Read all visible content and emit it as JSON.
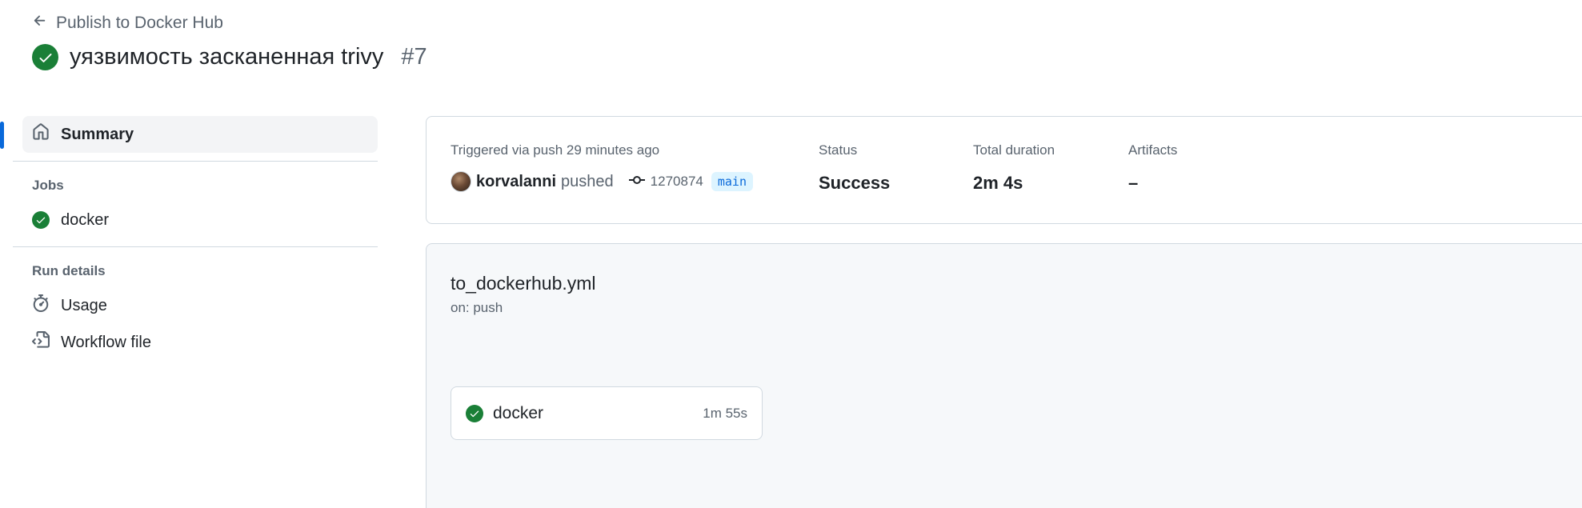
{
  "header": {
    "back_label": "Publish to Docker Hub",
    "title": "уязвимость засканенная trivy",
    "run_number": "#7"
  },
  "sidebar": {
    "summary_label": "Summary",
    "jobs_heading": "Jobs",
    "jobs": [
      {
        "label": "docker"
      }
    ],
    "run_details_heading": "Run details",
    "usage_label": "Usage",
    "workflow_file_label": "Workflow file"
  },
  "summary": {
    "triggered_label": "Triggered via push 29 minutes ago",
    "actor": "korvalanni",
    "action": "pushed",
    "commit_sha": "1270874",
    "branch": "main",
    "status_label": "Status",
    "status_value": "Success",
    "duration_label": "Total duration",
    "duration_value": "2m 4s",
    "artifacts_label": "Artifacts",
    "artifacts_value": "–"
  },
  "graph": {
    "workflow_file": "to_dockerhub.yml",
    "trigger": "on: push",
    "job": {
      "name": "docker",
      "duration": "1m 55s"
    }
  },
  "colors": {
    "success": "#1a7f37",
    "accent": "#0969da",
    "muted": "#59636e"
  }
}
